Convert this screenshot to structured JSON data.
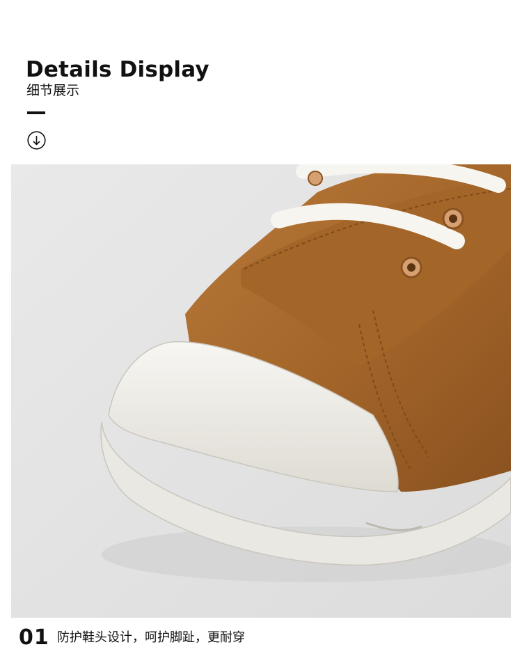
{
  "header": {
    "title": "Details Display",
    "subtitle": "细节展示",
    "scroll_icon": "arrow-down-circle-icon"
  },
  "photo": {
    "subject": "shoe-toe-closeup-image",
    "colors": {
      "background": "#e6e6e6",
      "leather": "#a8682a",
      "sole": "#f2f0ea",
      "lace": "#f7f5ef"
    }
  },
  "feature": {
    "number": "01",
    "caption": "防护鞋头设计，呵护脚趾，更耐穿"
  }
}
